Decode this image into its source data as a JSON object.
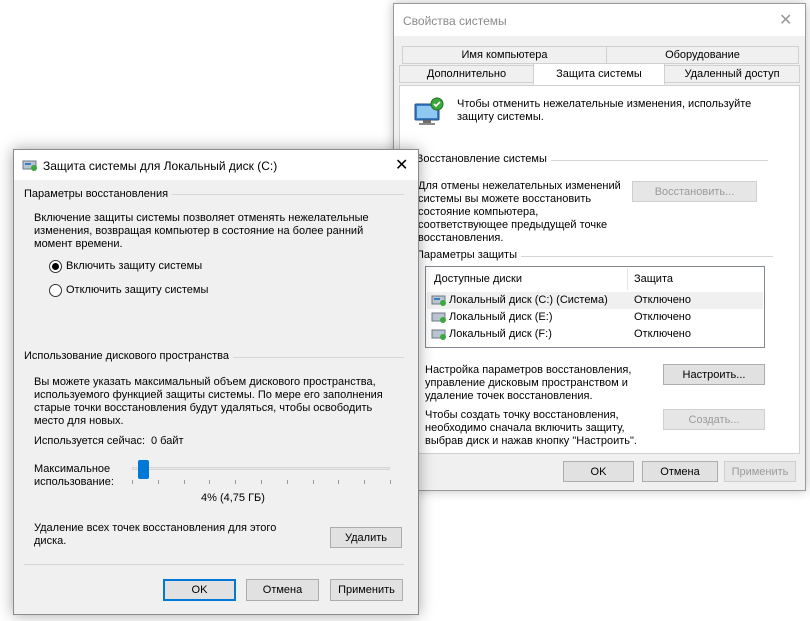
{
  "props_window": {
    "title": "Свойства системы",
    "tabs_row1": [
      "Имя компьютера",
      "Оборудование"
    ],
    "tabs_row2": [
      "Дополнительно",
      "Защита системы",
      "Удаленный доступ"
    ],
    "active_tab": "Защита системы",
    "intro": [
      "Чтобы отменить нежелательные изменения, используйте",
      "защиту системы."
    ],
    "restore_group": "Восстановление системы",
    "restore_desc": [
      "Для отмены нежелательных изменений",
      "системы вы можете восстановить",
      "состояние компьютера,",
      "соответствующее предыдущей точке",
      "восстановления."
    ],
    "restore_button": "Восстановить...",
    "protection_group": "Параметры защиты",
    "columns": [
      "Доступные диски",
      "Защита"
    ],
    "drives": [
      {
        "name": "Локальный диск (C:) (Система)",
        "protection": "Отключено"
      },
      {
        "name": "Локальный диск (E:)",
        "protection": "Отключено"
      },
      {
        "name": "Локальный диск (F:)",
        "protection": "Отключено"
      }
    ],
    "configure_desc": [
      "Настройка параметров восстановления,",
      "управление дисковым пространством и",
      "удаление точек восстановления."
    ],
    "configure_button": "Настроить...",
    "create_desc": [
      "Чтобы создать точку восстановления,",
      "необходимо сначала включить защиту,",
      "выбрав диск и нажав кнопку \"Настроить\"."
    ],
    "create_button": "Создать...",
    "ok": "OK",
    "cancel": "Отмена",
    "apply": "Применить"
  },
  "dialog": {
    "title": "Защита системы для Локальный диск (C:)",
    "restore_settings_group": "Параметры восстановления",
    "restore_settings_desc": [
      "Включение защиты системы позволяет отменять нежелательные",
      "изменения, возвращая компьютер в состояние на более ранний",
      "момент времени."
    ],
    "radio_enable": "Включить защиту системы",
    "radio_disable": "Отключить защиту системы",
    "selected_radio": "enable",
    "disk_usage_group": "Использование дискового пространства",
    "disk_usage_desc": [
      "Вы можете указать максимальный объем дискового пространства,",
      "используемого функцией защиты системы. По мере его заполнения",
      "старые точки восстановления будут удаляться, чтобы освободить",
      "место для новых."
    ],
    "current_usage_label": "Используется сейчас:",
    "current_usage_value": "0 байт",
    "max_usage_label": [
      "Максимальное",
      "использование:"
    ],
    "max_usage_value": "4% (4,75 ГБ)",
    "slider_fraction": 0.04,
    "delete_desc": [
      "Удаление всех точек восстановления для этого",
      "диска."
    ],
    "delete_button": "Удалить",
    "ok": "OK",
    "cancel": "Отмена",
    "apply": "Применить"
  },
  "colors": {
    "accent": "#0078d7",
    "window_bg": "#f0f0f0",
    "disabled_text": "#9a9a9a"
  }
}
